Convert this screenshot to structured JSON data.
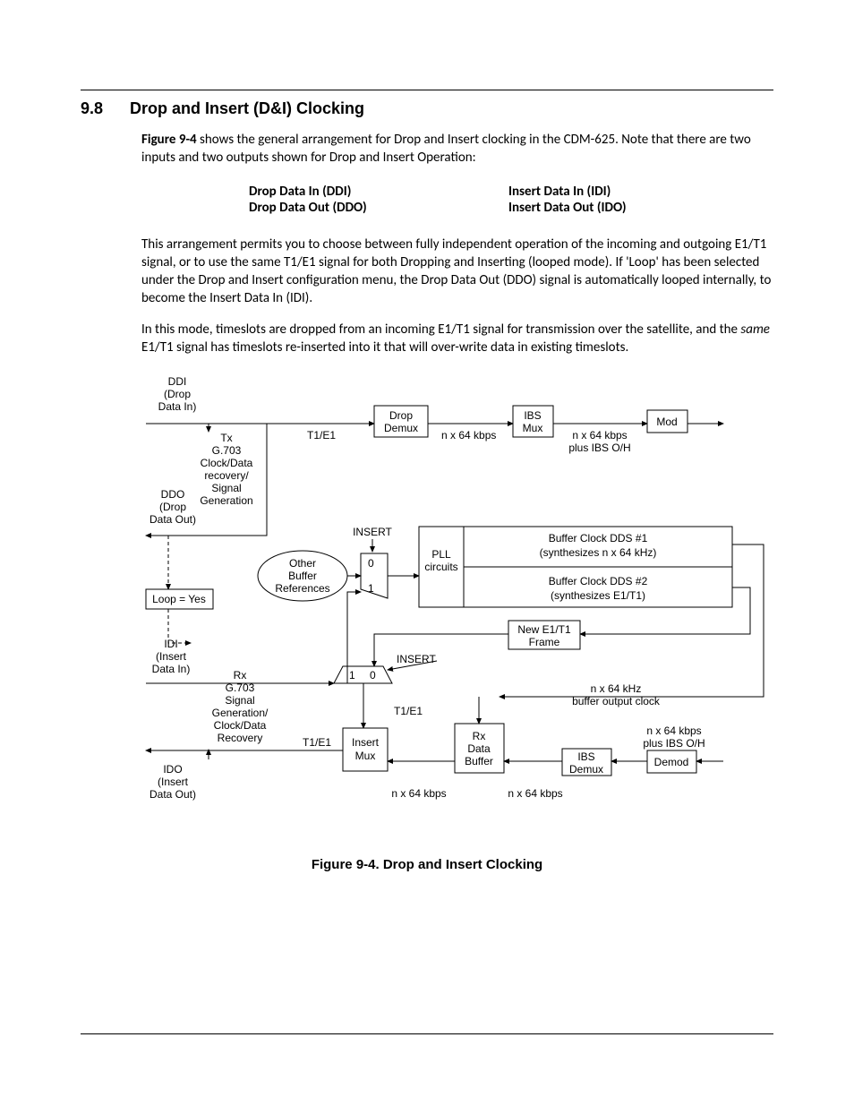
{
  "section": {
    "number": "9.8",
    "title": "Drop and Insert (D&I) Clocking"
  },
  "para1": "Figure 9-4 shows the general arrangement for Drop and Insert clocking in the CDM-625. Note that there are two inputs and two outputs shown for Drop and Insert Operation:",
  "para1_boldlead": "Figure 9-4",
  "signals": {
    "r1c1": "Drop Data In (DDI)",
    "r1c2": "Insert Data In (IDI)",
    "r2c1": "Drop Data Out (DDO)",
    "r2c2": "Insert Data Out (IDO)"
  },
  "para2": "This arrangement permits you to choose between fully independent operation of the incoming and outgoing E1/T1 signal, or to use the same T1/E1 signal for both Dropping and Inserting (looped mode). If 'Loop' has been selected under the Drop and Insert configuration menu, the Drop Data Out (DDO) signal is automatically looped internally, to become the Insert Data In (IDI).",
  "para3a": "In this mode, timeslots are dropped from an incoming E1/T1 signal for transmission over the satellite, and the ",
  "para3_italic": "same",
  "para3b": " E1/T1 signal has timeslots re-inserted into it that will over-write data in existing timeslots.",
  "figure_caption": "Figure 9-4. Drop and Insert Clocking",
  "diagram_labels": {
    "ddi1": "DDI",
    "ddi2": "(Drop",
    "ddi3": "Data In)",
    "ddo1": "DDO",
    "ddo2": "(Drop",
    "ddo3": "Data Out)",
    "idi1": "IDI",
    "idi2": "(Insert",
    "idi3": "Data In)",
    "ido1": "IDO",
    "ido2": "(Insert",
    "ido3": "Data Out)",
    "loop": "Loop = Yes",
    "tx1": "Tx",
    "tx2": "G.703",
    "tx3": "Clock/Data",
    "tx4": "recovery/",
    "tx5": "Signal",
    "tx6": "Generation",
    "rx1": "Rx",
    "rx2": "G.703",
    "rx3": "Signal",
    "rx4": "Generation/",
    "rx5": "Clock/Data",
    "rx6": "Recovery",
    "dropdemux1": "Drop",
    "dropdemux2": "Demux",
    "ibsmux1": "IBS",
    "ibsmux2": "Mux",
    "mod": "Mod",
    "other1": "Other",
    "other2": "Buffer",
    "other3": "References",
    "pll1": "PLL",
    "pll2": "circuits",
    "dds1a": "Buffer Clock DDS #1",
    "dds1b": "(synthesizes n x 64 kHz)",
    "dds2a": "Buffer Clock DDS #2",
    "dds2b": "(synthesizes E1/T1)",
    "newframe1": "New E1/T1",
    "newframe2": "Frame",
    "insertmux1": "Insert",
    "insertmux2": "Mux",
    "rxbuf1": "Rx",
    "rxbuf2": "Data",
    "rxbuf3": "Buffer",
    "ibsdemux1": "IBS",
    "ibsdemux2": "Demux",
    "demod": "Demod",
    "insert_top": "INSERT",
    "insert_mid": "INSERT",
    "t1e1_1": "T1/E1",
    "t1e1_2": "T1/E1",
    "t1e1_3": "T1/E1",
    "nx64_1": "n x 64 kbps",
    "nx64_2": "n x 64 kbps",
    "nx64_3": "n x 64 kbps",
    "nx64oh1": "n x 64 kbps",
    "nx64oh1b": "plus IBS O/H",
    "nx64oh2": "n x 64 kbps",
    "nx64oh2b": "plus IBS O/H",
    "nx64khz1": "n x 64 kHz",
    "nx64khz2": "buffer output clock",
    "sel0": "0",
    "sel1": "1",
    "sel1b": "1",
    "sel0b": "0"
  }
}
